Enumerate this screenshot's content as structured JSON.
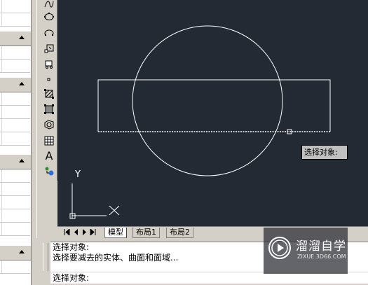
{
  "properties_palette": {
    "sections": [
      "properties-general",
      "properties-3d",
      "properties-geometry",
      "properties-misc"
    ]
  },
  "toolbar": {
    "tools": [
      "spline-icon",
      "ellipse-icon",
      "ellipse-arc-icon",
      "insert-block-icon",
      "make-block-icon",
      "point-icon",
      "hatch-icon",
      "gradient-icon",
      "region-icon",
      "table-icon",
      "multiline-text-icon",
      "add-selected-icon"
    ],
    "text_tool_glyph": "A"
  },
  "drawing": {
    "tooltip": "选择对象:",
    "ucs_y_label": "Y",
    "background_color": "#232a33",
    "entity_color": "#ffffff"
  },
  "tabs": {
    "model": "模型",
    "layout1": "布局1",
    "layout2": "布局2"
  },
  "command_line": {
    "history": [
      "选择对象:",
      "选择要减去的实体、曲面和面域..."
    ],
    "prompt": "选择对象:"
  },
  "watermark": {
    "text": "溜溜自学",
    "url": "ZIXUE.3D66.COM"
  }
}
